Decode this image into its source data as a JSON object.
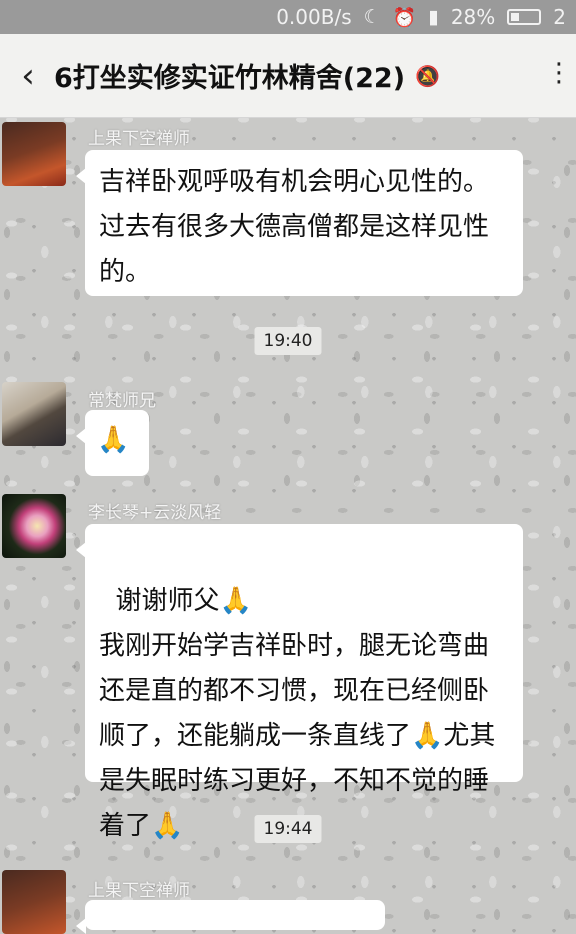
{
  "status_bar": {
    "net_speed": "0.00B/s",
    "moon_icon": "moon-icon",
    "alarm_icon": "alarm-icon",
    "signal_icon": "signal-icon",
    "battery_percent": "28%",
    "trailing": "2"
  },
  "header": {
    "title": "6打坐实修实证竹林精舍(22)",
    "back_icon": "‹",
    "mute_icon": "🔕",
    "more_icon": "⋮"
  },
  "messages": [
    {
      "sender": "上果下空禅师",
      "text": "吉祥卧观呼吸有机会明心见性的。过去有很多大德高僧都是这样见性的。"
    },
    {
      "time": "19:40"
    },
    {
      "sender": "常梵师兄",
      "text": "🙏"
    },
    {
      "sender": "李长琴+云淡风轻",
      "text": "谢谢师父🙏\n我刚开始学吉祥卧时，腿无论弯曲还是直的都不习惯，现在已经侧卧顺了，还能躺成一条直线了🙏尤其是失眠时练习更好，不知不觉的睡着了🙏"
    },
    {
      "time": "19:44"
    },
    {
      "sender": "上果下空禅师"
    }
  ]
}
